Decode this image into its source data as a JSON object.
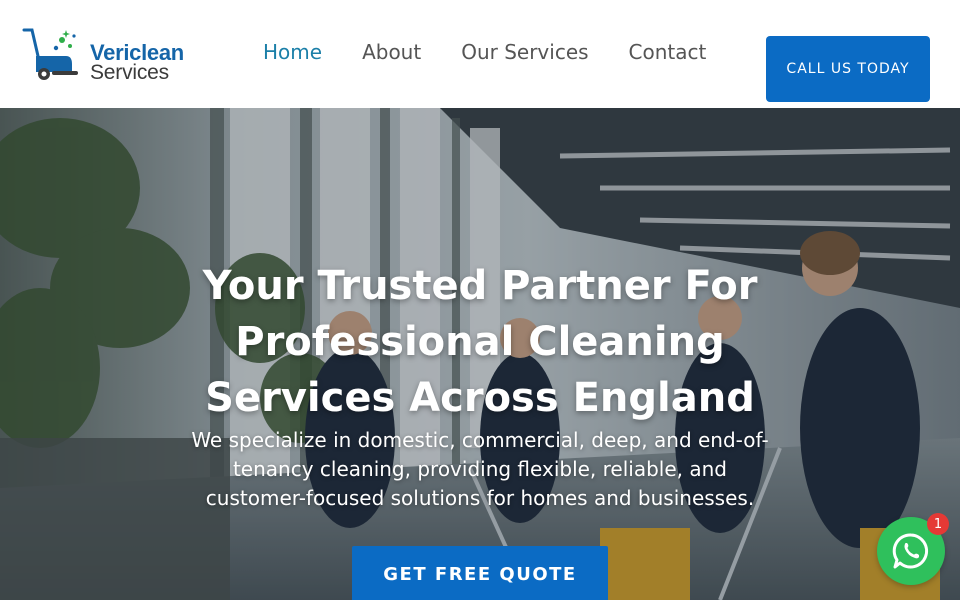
{
  "brand": {
    "name_line1": "Vericlean",
    "name_line2": "Services",
    "primary_color": "#0b6bc4",
    "accent_color": "#1b7fa8",
    "logo_icon": "floor-scrubber-icon"
  },
  "nav": {
    "items": [
      {
        "label": "Home",
        "active": true
      },
      {
        "label": "About",
        "active": false
      },
      {
        "label": "Our Services",
        "active": false
      },
      {
        "label": "Contact",
        "active": false
      }
    ],
    "cta_label": "CALL US TODAY"
  },
  "hero": {
    "title": "Your Trusted Partner For Professional Cleaning Services Across England",
    "subtitle": "We specialize in domestic, commercial, deep, and end-of-tenancy cleaning, providing flexible, reliable, and customer-focused solutions for homes and businesses.",
    "button_label": "GET FREE QUOTE",
    "background": "photo of cleaning staff mopping an office floor"
  },
  "whatsapp": {
    "icon": "whatsapp-icon",
    "badge_count": "1",
    "color": "#2fc05c"
  }
}
